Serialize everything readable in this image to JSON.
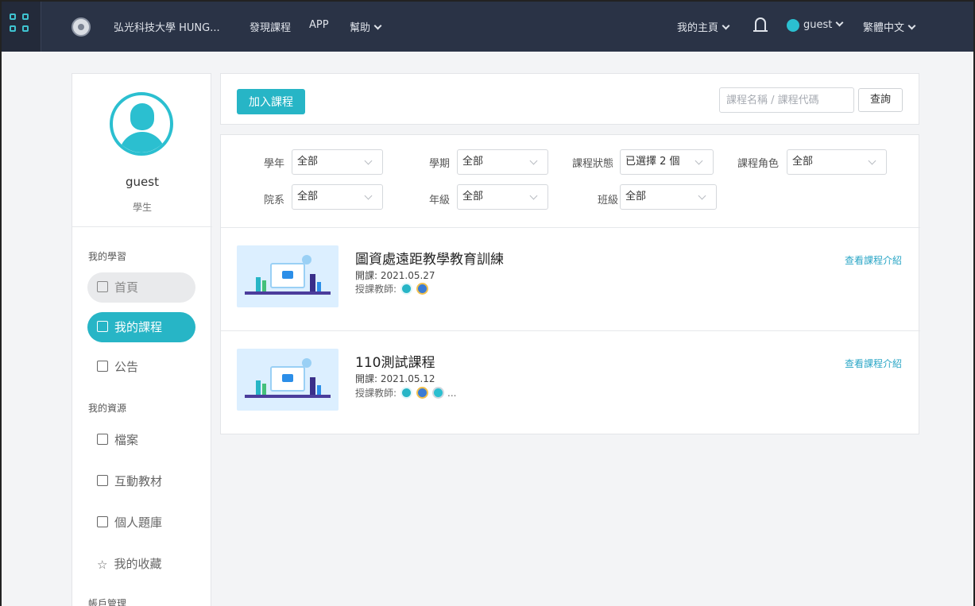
{
  "topbar": {
    "school_name": "弘光科技大學 HUNG...",
    "discover": "發現課程",
    "app": "APP",
    "help": "幫助",
    "my_home": "我的主頁",
    "user": "guest",
    "language": "繁體中文"
  },
  "sidebar": {
    "user_name": "guest",
    "user_role": "學生",
    "section_learning": "我的學習",
    "home": "首頁",
    "my_courses": "我的課程",
    "announcement": "公告",
    "section_resources": "我的資源",
    "files": "檔案",
    "interactive": "互動教材",
    "question_bank": "個人題庫",
    "favorites": "我的收藏",
    "section_account": "帳戶管理"
  },
  "toolbar": {
    "join_course": "加入課程",
    "search_placeholder": "課程名稱 / 課程代碼",
    "query": "查詢"
  },
  "filters": {
    "year_label": "學年",
    "year_value": "全部",
    "term_label": "學期",
    "term_value": "全部",
    "status_label": "課程狀態",
    "status_value": "已選擇 2 個",
    "role_label": "課程角色",
    "role_value": "全部",
    "dept_label": "院系",
    "dept_value": "全部",
    "grade_label": "年級",
    "grade_value": "全部",
    "class_label": "班級",
    "class_value": "全部"
  },
  "courses": [
    {
      "title": "圖資處遠距教學教育訓練",
      "date": "開課: 2021.05.27",
      "teacher_label": "授課教師:",
      "more": "",
      "link": "查看課程介紹"
    },
    {
      "title": "110測試課程",
      "date": "開課: 2021.05.12",
      "teacher_label": "授課教師:",
      "more": "...",
      "link": "查看課程介紹"
    }
  ],
  "colors": {
    "accent": "#27b5c6",
    "topbar": "#2a3346",
    "link": "#2aa6c6"
  }
}
